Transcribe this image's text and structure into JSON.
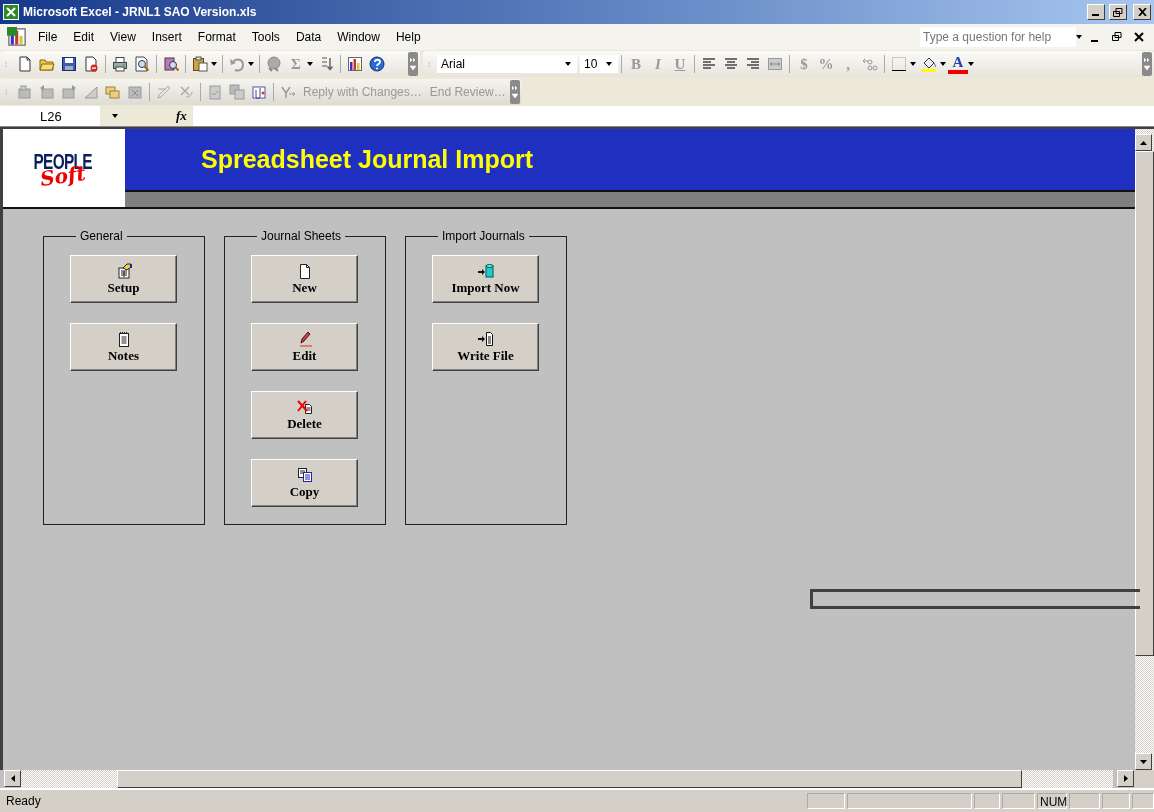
{
  "window": {
    "title": "Microsoft Excel - JRNL1 SAO Version.xls"
  },
  "menu": [
    "File",
    "Edit",
    "View",
    "Insert",
    "Format",
    "Tools",
    "Data",
    "Window",
    "Help"
  ],
  "help_field": {
    "placeholder": "Type a question for help"
  },
  "formatting": {
    "font": "Arial",
    "size": "10",
    "glyphs": [
      {
        "text": "B",
        "disabled": true
      },
      {
        "text": "I",
        "disabled": true
      },
      {
        "text": "U",
        "disabled": true
      },
      {
        "text": "$",
        "disabled": true
      },
      {
        "text": "%",
        "disabled": true
      },
      {
        "text": ",",
        "disabled": true
      }
    ],
    "font_color_glyph": "A",
    "sum_glyph": "Σ"
  },
  "reviewing": [
    {
      "label": "Reply with Changes…",
      "disabled": true
    },
    {
      "label": "End Review…",
      "disabled": true
    }
  ],
  "formula_bar": {
    "name_box": "L26",
    "fx": "fx"
  },
  "banner": {
    "logo_top": "PEOPLE",
    "logo_bottom": "Soft",
    "title": "Spreadsheet Journal Import"
  },
  "groups": [
    {
      "title": "General",
      "buttons": [
        "Setup",
        "Notes"
      ]
    },
    {
      "title": "Journal Sheets",
      "buttons": [
        "New",
        "Edit",
        "Delete",
        "Copy"
      ]
    },
    {
      "title": "Import Journals",
      "buttons": [
        "Import Now",
        "Write File"
      ]
    }
  ],
  "status_bar": {
    "mode": "Ready",
    "indicator": "NUM"
  }
}
